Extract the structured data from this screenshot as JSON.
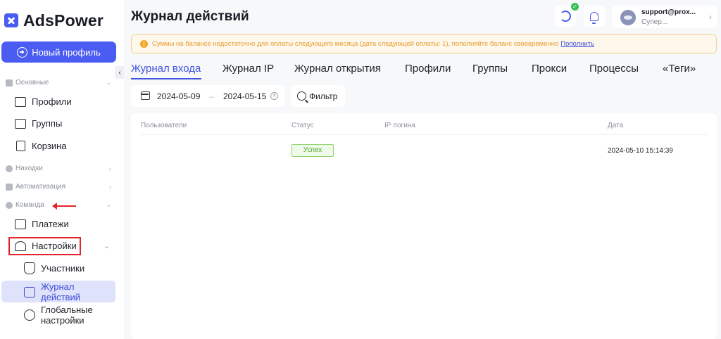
{
  "sidebar": {
    "logo_text": "AdsPower",
    "new_profile_label": "Новый профиль",
    "collapse_glyph": "‹",
    "sections": {
      "basic": "Основные",
      "finds": "Находки",
      "automation": "Автоматизация",
      "team": "Команда"
    },
    "items": {
      "profiles": "Профили",
      "groups": "Группы",
      "trash": "Корзина",
      "payments": "Платежи",
      "settings": "Настройки"
    },
    "sub_items": {
      "members": "Участники",
      "action_log_line1": "Журнал",
      "action_log_line2": "действий",
      "global_line1": "Глобальные",
      "global_line2": "настройки"
    }
  },
  "header": {
    "title": "Журнал действий",
    "account_email": "support@prox...",
    "account_role": "Супер...",
    "check_glyph": "✓"
  },
  "alert": {
    "text": "Суммы на балансе недостаточно для оплаты следующего месяца (дата следующей оплаты: 1), пополняйте баланс своевременно",
    "link": "Пополнить"
  },
  "tabs": [
    "Журнал входа",
    "Журнал IP",
    "Журнал открытия",
    "Профили",
    "Группы",
    "Прокси",
    "Процессы",
    "«Теги»"
  ],
  "filters": {
    "date_from": "2024-05-09",
    "date_to": "2024-05-15",
    "filter_label": "Фильтр"
  },
  "table": {
    "columns": [
      "Пользователи",
      "Статус",
      "IP логина",
      "Дата"
    ],
    "rows": [
      {
        "user": "",
        "status": "Успех",
        "ip": "",
        "date": "2024-05-10 15:14:39"
      }
    ]
  },
  "colors": {
    "accent": "#4b5cf2",
    "warning": "#e89a2a",
    "success": "#52a635",
    "highlight_red": "#e0262a"
  }
}
